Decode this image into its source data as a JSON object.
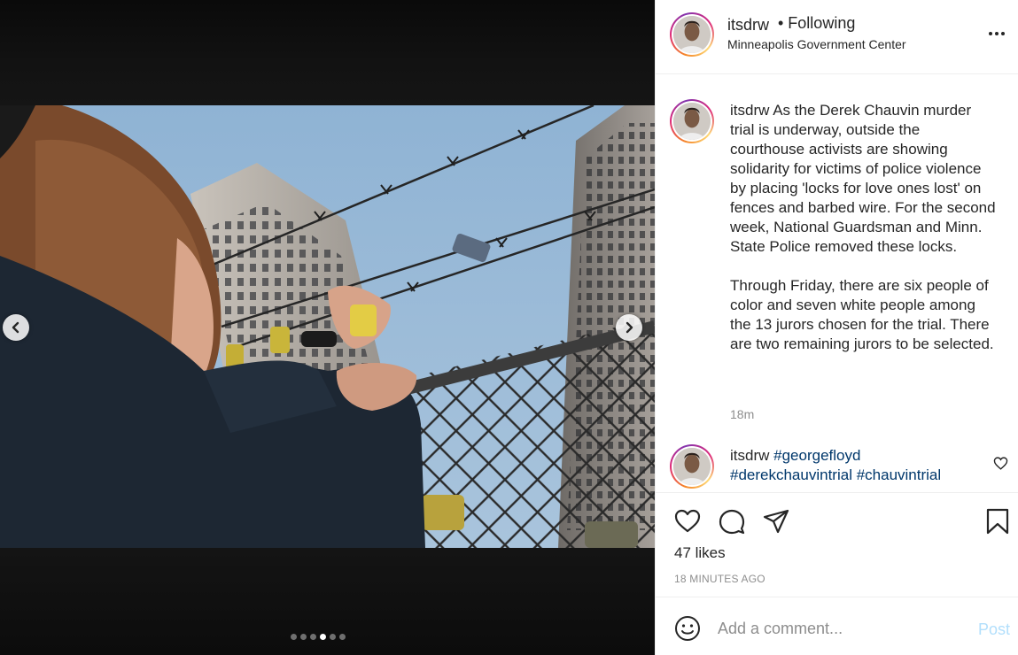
{
  "post": {
    "username": "itsdrw",
    "follow_status": "• Following",
    "location": "Minneapolis Government Center",
    "carousel": {
      "total": 6,
      "active_index": 3
    },
    "caption": {
      "username": "itsdrw",
      "paragraph_1": "As the Derek Chauvin murder trial is underway, outside the courthouse activists are showing solidarity for victims of police violence by placing 'locks for love ones lost' on fences and barbed wire. For the second week, National Guardsman and Minn. State Police removed these locks.",
      "paragraph_2": "Through Friday, there are six people of color and seven white people among the 13 jurors chosen for the trial. There are two remaining jurors to be selected.",
      "time": "18m"
    },
    "comment": {
      "username": "itsdrw",
      "tags": [
        "#georgefloyd",
        "#derekchauvintrial",
        "#chauvintrial"
      ]
    },
    "likes_text": "47 likes",
    "posted_ago": "18 MINUTES AGO",
    "add_comment_placeholder": "Add a comment...",
    "post_button_label": "Post"
  },
  "icons": {
    "prev": "chevron-left-icon",
    "next": "chevron-right-icon",
    "more": "more-options-icon",
    "like": "heart-icon",
    "comment": "comment-bubble-icon",
    "share": "paper-plane-icon",
    "save": "bookmark-icon",
    "emoji": "smiley-icon"
  },
  "colors": {
    "text": "#262626",
    "secondary": "#8e8e8e",
    "hashtag": "#00376b",
    "post_disabled": "#b2dffc"
  }
}
